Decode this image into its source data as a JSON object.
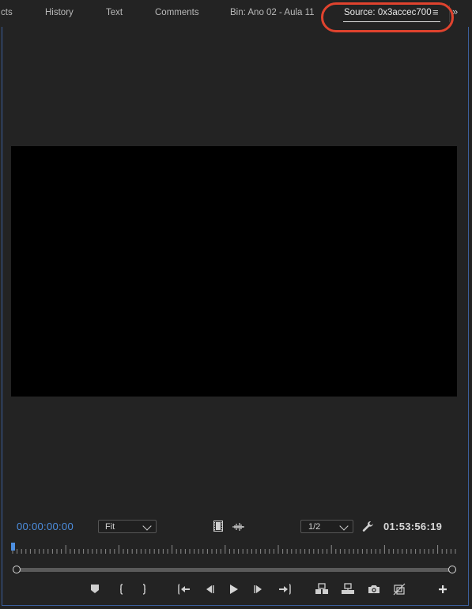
{
  "tabs": [
    {
      "label": "cts",
      "active": false
    },
    {
      "label": "History",
      "active": false
    },
    {
      "label": "Text",
      "active": false
    },
    {
      "label": "Comments",
      "active": false
    },
    {
      "label": "Bin: Ano 02 - Aula 11",
      "active": false
    },
    {
      "label": "Source: 0x3accec700",
      "active": true
    }
  ],
  "panel_menu_glyph": "≡",
  "overflow_glyph": "»",
  "colors": {
    "accent_timecode": "#4d8fe0",
    "highlight_ring": "#e0432e",
    "panel_border": "#3b5f9c"
  },
  "controls": {
    "timecode_in": "00:00:00:00",
    "zoom_select": "Fit",
    "resolution_select": "1/2",
    "timecode_duration": "01:53:56:19"
  },
  "icons": {
    "drag_video": "film-strip-icon",
    "drag_audio": "audio-waveform-icon",
    "settings": "wrench-icon",
    "marker": "add-marker-icon",
    "mark_in": "mark-in-icon",
    "mark_out": "mark-out-icon",
    "go_to_in": "go-to-in-icon",
    "step_back": "step-back-icon",
    "play": "play-icon",
    "step_forward": "step-forward-icon",
    "go_to_out": "go-to-out-icon",
    "insert": "insert-icon",
    "overwrite": "overwrite-icon",
    "export_frame": "camera-icon",
    "toggle_multicam": "multicam-icon",
    "button_editor": "plus-icon"
  }
}
